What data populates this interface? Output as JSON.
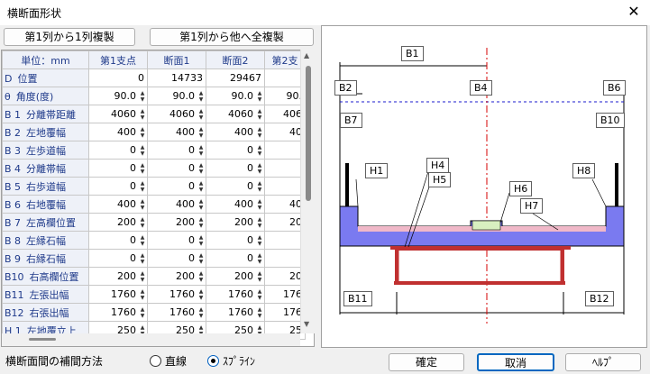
{
  "window": {
    "title": "横断面形状",
    "close_label": "✕"
  },
  "toolbar": {
    "copy_col1_label": "第1列から1列複製",
    "copy_col1_all_label": "第1列から他へ全複製"
  },
  "grid": {
    "corner_label": "単位：mm",
    "columns": [
      "第1支点",
      "断面1",
      "断面2",
      "第2支"
    ],
    "rows": [
      {
        "code": "D",
        "label": "位置",
        "values": [
          "0",
          "14733",
          "29467",
          ""
        ],
        "spin": false
      },
      {
        "code": "θ",
        "label": "角度(度)",
        "values": [
          "90.0",
          "90.0",
          "90.0",
          "90."
        ],
        "spin": true
      },
      {
        "code": "B 1",
        "label": "分離帯距離",
        "values": [
          "4060",
          "4060",
          "4060",
          "406"
        ],
        "spin": true
      },
      {
        "code": "B 2",
        "label": "左地覆幅",
        "values": [
          "400",
          "400",
          "400",
          "40"
        ],
        "spin": true
      },
      {
        "code": "B 3",
        "label": "左歩道幅",
        "values": [
          "0",
          "0",
          "0",
          ""
        ],
        "spin": true
      },
      {
        "code": "B 4",
        "label": "分離帯幅",
        "values": [
          "0",
          "0",
          "0",
          ""
        ],
        "spin": true
      },
      {
        "code": "B 5",
        "label": "右歩道幅",
        "values": [
          "0",
          "0",
          "0",
          ""
        ],
        "spin": true
      },
      {
        "code": "B 6",
        "label": "右地覆幅",
        "values": [
          "400",
          "400",
          "400",
          "40"
        ],
        "spin": true
      },
      {
        "code": "B 7",
        "label": "左高欄位置",
        "values": [
          "200",
          "200",
          "200",
          "20"
        ],
        "spin": true
      },
      {
        "code": "B 8",
        "label": "左縁石幅",
        "values": [
          "0",
          "0",
          "0",
          ""
        ],
        "spin": true
      },
      {
        "code": "B 9",
        "label": "右縁石幅",
        "values": [
          "0",
          "0",
          "0",
          ""
        ],
        "spin": true
      },
      {
        "code": "B10",
        "label": "右高欄位置",
        "values": [
          "200",
          "200",
          "200",
          "20"
        ],
        "spin": true
      },
      {
        "code": "B11",
        "label": "左張出幅",
        "values": [
          "1760",
          "1760",
          "1760",
          "176"
        ],
        "spin": true
      },
      {
        "code": "B12",
        "label": "右張出幅",
        "values": [
          "1760",
          "1760",
          "1760",
          "176"
        ],
        "spin": true
      },
      {
        "code": "H 1",
        "label": "左地覆立上",
        "values": [
          "250",
          "250",
          "250",
          "25"
        ],
        "spin": true
      }
    ]
  },
  "diagram": {
    "labels": [
      "B1",
      "B2",
      "B4",
      "B6",
      "B7",
      "B10",
      "H1",
      "H4",
      "H5",
      "H6",
      "H7",
      "H8",
      "B11",
      "B12"
    ]
  },
  "footer": {
    "interp_label": "横断面間の補間方法",
    "radio_linear": "直線",
    "radio_spline": "ｽﾌﾟﾗｲﾝ",
    "selected": "spline",
    "ok_label": "確定",
    "cancel_label": "取消",
    "help_label": "ﾍﾙﾌﾟ"
  }
}
